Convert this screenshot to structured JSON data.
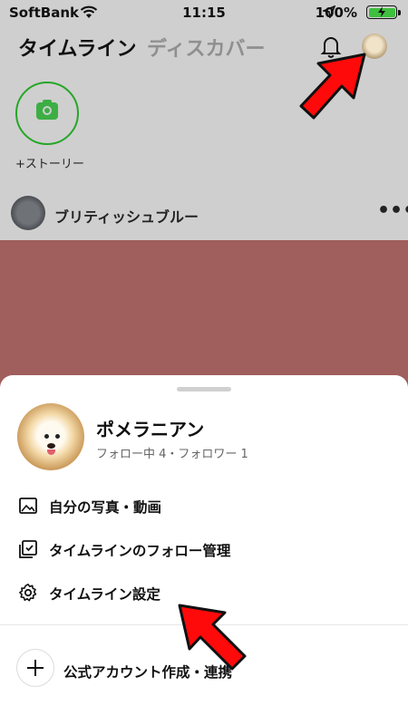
{
  "status_bar": {
    "carrier": "SoftBank",
    "time": "11:15",
    "battery": "100%"
  },
  "header": {
    "tab_timeline": "タイムライン",
    "tab_discover": "ディスカバー"
  },
  "stories": {
    "add_label": "+ストーリー"
  },
  "post": {
    "author": "ブリティッシュブルー",
    "more": "•••"
  },
  "profile": {
    "name": "ポメラニアン",
    "stats": "フォロー中 4・フォロワー 1"
  },
  "menu": {
    "items": [
      {
        "label": "自分の写真・動画",
        "icon": "image-icon"
      },
      {
        "label": "タイムラインのフォロー管理",
        "icon": "follow-manage-icon"
      },
      {
        "label": "タイムライン設定",
        "icon": "gear-icon"
      }
    ],
    "official_account": "公式アカウント作成・連携"
  },
  "colors": {
    "accent_green": "#3cae44",
    "arrow_red": "#ff0a0a",
    "overlay": "#cfcfcf"
  }
}
